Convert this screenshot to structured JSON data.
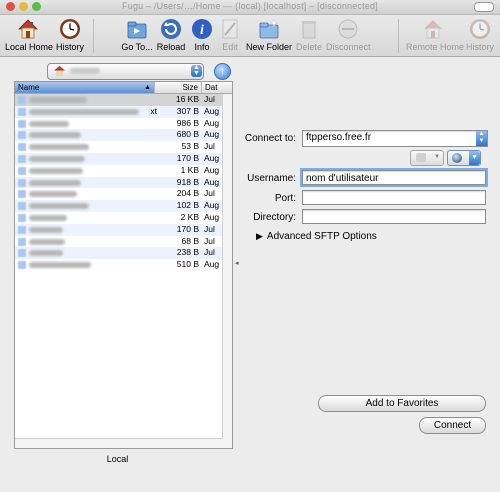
{
  "window": {
    "title": "Fugu – /Users/…/Home — (local) [localhost] – [disconnected]"
  },
  "toolbar": {
    "local_home": "Local Home",
    "history": "History",
    "goto": "Go To...",
    "reload": "Reload",
    "info": "Info",
    "edit": "Edit",
    "new_folder": "New Folder",
    "delete": "Delete",
    "disconnect": "Disconnect",
    "remote_home": "Remote Home",
    "remote_history": "History"
  },
  "local": {
    "path": "",
    "columns": {
      "name": "Name",
      "size": "Size",
      "date": "Dat"
    },
    "files": [
      {
        "ext": "",
        "size": "16 KB",
        "date": "Jul"
      },
      {
        "ext": "xt",
        "size": "307 B",
        "date": "Aug"
      },
      {
        "ext": "",
        "size": "986 B",
        "date": "Aug"
      },
      {
        "ext": "",
        "size": "680 B",
        "date": "Aug"
      },
      {
        "ext": "",
        "size": "53 B",
        "date": "Jul"
      },
      {
        "ext": "",
        "size": "170 B",
        "date": "Aug"
      },
      {
        "ext": "",
        "size": "1 KB",
        "date": "Aug"
      },
      {
        "ext": "",
        "size": "918 B",
        "date": "Aug"
      },
      {
        "ext": "",
        "size": "204 B",
        "date": "Jul"
      },
      {
        "ext": "",
        "size": "102 B",
        "date": "Aug"
      },
      {
        "ext": "",
        "size": "2 KB",
        "date": "Aug"
      },
      {
        "ext": "",
        "size": "170 B",
        "date": "Jul"
      },
      {
        "ext": "",
        "size": "68 B",
        "date": "Jul"
      },
      {
        "ext": "",
        "size": "238 B",
        "date": "Jul"
      },
      {
        "ext": "",
        "size": "510 B",
        "date": "Aug"
      }
    ],
    "label": "Local"
  },
  "connect": {
    "connect_to_label": "Connect to:",
    "server": "ftpperso.free.fr",
    "username_label": "Username:",
    "username": "nom d'utilisateur",
    "port_label": "Port:",
    "port": "",
    "directory_label": "Directory:",
    "directory": "",
    "advanced": "Advanced SFTP Options",
    "add_favorites": "Add to Favorites",
    "connect_button": "Connect"
  }
}
